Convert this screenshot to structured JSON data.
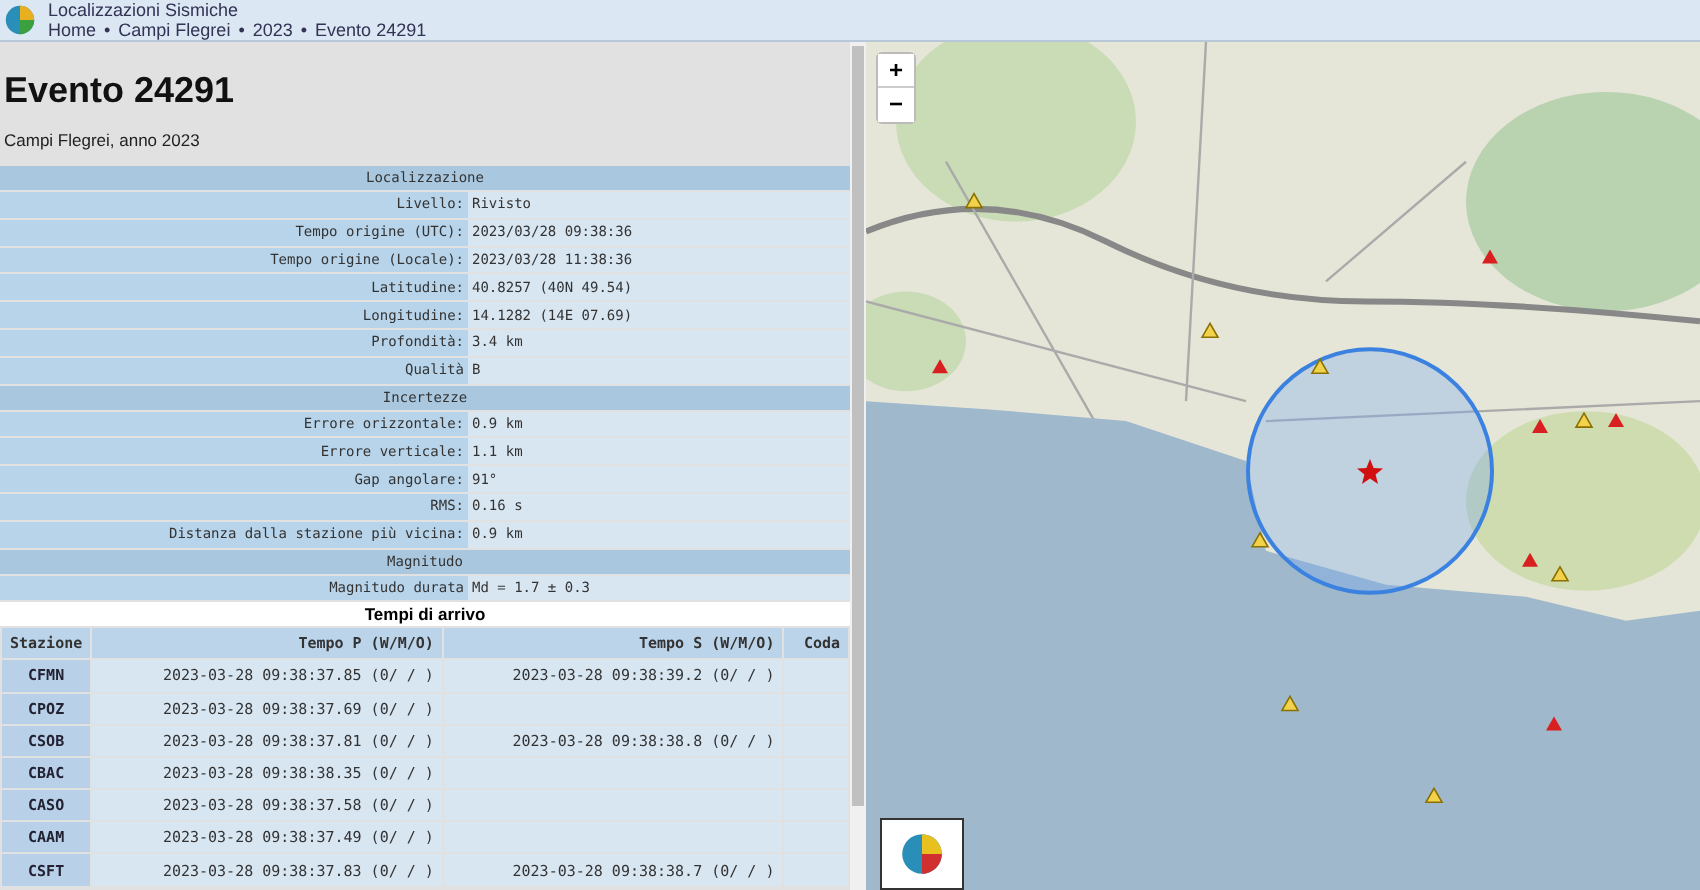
{
  "header": {
    "title": "Localizzazioni Sismiche",
    "breadcrumbs": [
      "Home",
      "Campi Flegrei",
      "2023",
      "Evento 24291"
    ],
    "breadcrumb_separator": "•"
  },
  "event": {
    "title": "Evento 24291",
    "subtitle": "Campi Flegrei, anno 2023"
  },
  "details": [
    {
      "heading": "Localizzazione",
      "rows": [
        {
          "label": "Livello:",
          "value": "Rivisto"
        },
        {
          "label": "Tempo origine (UTC):",
          "value": "2023/03/28 09:38:36"
        },
        {
          "label": "Tempo origine (Locale):",
          "value": "2023/03/28 11:38:36"
        },
        {
          "label": "Latitudine:",
          "value": "40.8257 (40N 49.54)"
        },
        {
          "label": "Longitudine:",
          "value": "14.1282 (14E 07.69)"
        },
        {
          "label": "Profondità:",
          "value": "3.4 km"
        },
        {
          "label": "Qualità",
          "value": "B"
        }
      ]
    },
    {
      "heading": "Incertezze",
      "rows": [
        {
          "label": "Errore orizzontale:",
          "value": "0.9 km"
        },
        {
          "label": "Errore verticale:",
          "value": "1.1 km"
        },
        {
          "label": "Gap angolare:",
          "value": "91°"
        },
        {
          "label": "RMS:",
          "value": "0.16 s"
        },
        {
          "label": "Distanza dalla stazione più vicina:",
          "value": "0.9 km"
        }
      ]
    },
    {
      "heading": "Magnitudo",
      "rows": [
        {
          "label": "Magnitudo durata",
          "value": "Md = 1.7 ± 0.3"
        }
      ]
    }
  ],
  "arrivals": {
    "title": "Tempi di arrivo",
    "columns": [
      "Stazione",
      "Tempo P (W/M/O)",
      "Tempo S (W/M/O)",
      "Coda"
    ],
    "rows": [
      [
        "CFMN",
        "2023-03-28 09:38:37.85 (0/ / )",
        "2023-03-28 09:38:39.2 (0/ / )"
      ],
      [
        "CPOZ",
        "2023-03-28 09:38:37.69 (0/ / )",
        ""
      ],
      [
        "CSOB",
        "2023-03-28 09:38:37.81 (0/ / )",
        "2023-03-28 09:38:38.8 (0/ / )"
      ],
      [
        "CBAC",
        "2023-03-28 09:38:38.35 (0/ / )",
        ""
      ],
      [
        "CASO",
        "2023-03-28 09:38:37.58 (0/ / )",
        ""
      ],
      [
        "CAAM",
        "2023-03-28 09:38:37.49 (0/ / )",
        ""
      ],
      [
        "CSFT",
        "2023-03-28 09:38:37.83 (0/ / )",
        "2023-03-28 09:38:38.7 (0/ / )"
      ]
    ]
  },
  "map": {
    "zoom_in": "+",
    "zoom_out": "−"
  }
}
